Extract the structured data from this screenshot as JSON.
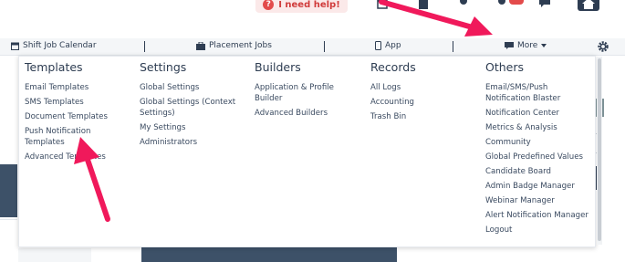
{
  "header": {
    "help_label": "I need help!",
    "icons": [
      "calendar-icon",
      "building-icon",
      "people-icon",
      "people-alert-icon",
      "chat-icon",
      "home-icon"
    ]
  },
  "navbar": {
    "items": [
      {
        "label": "Shift Job Calendar",
        "icon": "calendar-icon"
      },
      {
        "label": "Placement Jobs",
        "icon": "briefcase-icon"
      },
      {
        "label": "App",
        "icon": "phone-icon"
      },
      {
        "label": "More",
        "icon": "chat-icon"
      }
    ],
    "settings_icon": "gear-icon"
  },
  "menu": {
    "columns": [
      {
        "title": "Templates",
        "items": [
          "Email Templates",
          "SMS Templates",
          "Document Templates",
          "Push Notification Templates",
          "Advanced Templates"
        ]
      },
      {
        "title": "Settings",
        "items": [
          "Global Settings",
          "Global Settings (Context Settings)",
          "My Settings",
          "Administrators"
        ]
      },
      {
        "title": "Builders",
        "items": [
          "Application & Profile Builder",
          "Advanced Builders"
        ]
      },
      {
        "title": "Records",
        "items": [
          "All Logs",
          "Accounting",
          "Trash Bin"
        ]
      },
      {
        "title": "Others",
        "items": [
          "Email/SMS/Push Notification Blaster",
          "Notification Center",
          "Metrics & Analysis",
          "Community",
          "Global Predefined Values",
          "Candidate Board",
          "Admin Badge Manager",
          "Webinar Manager",
          "Alert Notification Manager",
          "Logout"
        ]
      }
    ]
  },
  "colors": {
    "arrow": "#f0195b",
    "navy": "#2e3d52",
    "help": "#e34b4b"
  }
}
